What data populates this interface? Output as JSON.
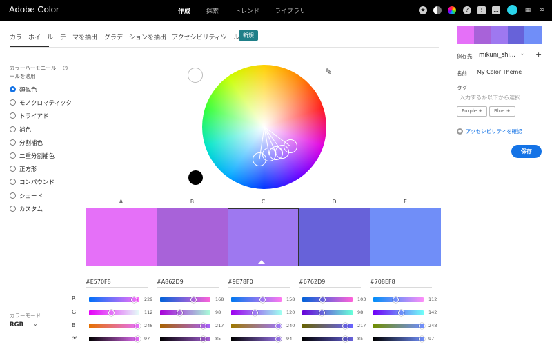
{
  "app": {
    "title": "Adobe Color"
  },
  "nav": [
    {
      "label": "作成",
      "active": true
    },
    {
      "label": "探索",
      "active": false
    },
    {
      "label": "トレンド",
      "active": false
    },
    {
      "label": "ライブラリ",
      "active": false
    }
  ],
  "top_icons": [
    "star-icon",
    "half-moon-icon",
    "color-wheel-icon",
    "help-icon",
    "feedback-icon",
    "chat-icon",
    "avatar",
    "apps-grid-icon",
    "creative-cloud-icon"
  ],
  "tabs": [
    "カラーホイール",
    "テーマを抽出",
    "グラデーションを抽出",
    "アクセシビリティツール"
  ],
  "new_badge": "新規",
  "harmony": {
    "title": "カラーハーモニールールを適用",
    "rules": [
      "類似色",
      "モノクロマティック",
      "トライアド",
      "補色",
      "分割補色",
      "二重分割補色",
      "正方形",
      "コンパウンド",
      "シェード",
      "カスタム"
    ],
    "selected": 0
  },
  "color_mode": {
    "label": "カラーモード",
    "value": "RGB"
  },
  "swatches": [
    {
      "label": "A",
      "hex": "#E570F8",
      "r": 229,
      "g": 112,
      "b": 248,
      "bright": 97
    },
    {
      "label": "B",
      "hex": "#A862D9",
      "r": 168,
      "g": 98,
      "b": 217,
      "bright": 85
    },
    {
      "label": "C",
      "hex": "#9E78F0",
      "r": 158,
      "g": 120,
      "b": 240,
      "bright": 94
    },
    {
      "label": "D",
      "hex": "#6762D9",
      "r": 103,
      "g": 98,
      "b": 217,
      "bright": 85
    },
    {
      "label": "E",
      "hex": "#708EF8",
      "r": 112,
      "g": 142,
      "b": 248,
      "bright": 97
    }
  ],
  "selected_swatch": 2,
  "channels": [
    "R",
    "G",
    "B"
  ],
  "save_panel": {
    "save_to_label": "保存先",
    "library": "mikuni_shi...",
    "name_label": "名前",
    "name_value": "My Color Theme",
    "tag_label": "タグ",
    "tag_placeholder": "入力するか以下から選択",
    "tags": [
      "Purple",
      "Blue"
    ],
    "a11y_link": "アクセシビリティを確認",
    "save_button": "保存"
  }
}
